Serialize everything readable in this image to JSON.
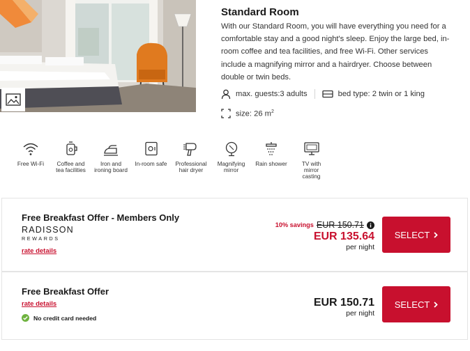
{
  "room": {
    "title": "Standard Room",
    "description": "With our Standard Room, you will have everything you need for a comfortable stay and a good night's sleep. Enjoy the large bed, in-room coffee and tea facilities, and free Wi-Fi. Other services include a magnifying mirror and a hairdryer. Choose between double or twin beds.",
    "max_guests": "max. guests:3 adults",
    "bed_type": "bed type: 2 twin or 1 king",
    "size_prefix": "size: 26 m",
    "size_sup": "2"
  },
  "amenities": [
    {
      "label": "Free Wi-Fi",
      "icon": "wifi-icon"
    },
    {
      "label": "Coffee and tea facilities",
      "icon": "coffee-icon"
    },
    {
      "label": "Iron and ironing board",
      "icon": "iron-icon"
    },
    {
      "label": "In-room safe",
      "icon": "safe-icon"
    },
    {
      "label": "Professional hair dryer",
      "icon": "hair-dryer-icon"
    },
    {
      "label": "Magnifying mirror",
      "icon": "mirror-icon"
    },
    {
      "label": "Rain shower",
      "icon": "shower-icon"
    },
    {
      "label": "TV with mirror casting",
      "icon": "tv-icon"
    }
  ],
  "offers": [
    {
      "name": "Free Breakfast Offer - Members Only",
      "rewards_logo_top": "RADISSON",
      "rewards_logo_bottom": "REWARDS",
      "rate_link": "rate details",
      "savings": "10% savings",
      "old_price": "EUR 150.71",
      "price": "EUR 135.64",
      "per_night": "per night",
      "button": "SELECT"
    },
    {
      "name": "Free Breakfast Offer",
      "rate_link": "rate details",
      "no_card": "No credit card needed",
      "price": "EUR 150.71",
      "per_night": "per night",
      "button": "SELECT"
    }
  ],
  "colors": {
    "accent": "#c8102e",
    "check_green": "#6fb33f"
  }
}
